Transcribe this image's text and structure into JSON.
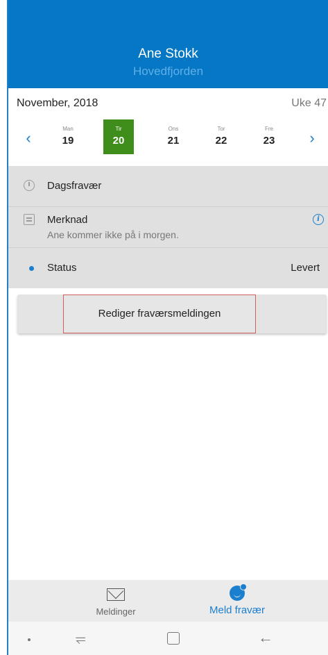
{
  "header": {
    "name": "Ane Stokk",
    "school": "Hovedfjorden"
  },
  "calendar": {
    "month": "November, 2018",
    "week": "Uke 47",
    "prev_icon": "chevron-left-icon",
    "next_icon": "chevron-right-icon",
    "days": [
      {
        "name": "Man",
        "date": "19",
        "selected": false
      },
      {
        "name": "Tir",
        "date": "20",
        "selected": true
      },
      {
        "name": "Ons",
        "date": "21",
        "selected": false
      },
      {
        "name": "Tor",
        "date": "22",
        "selected": false
      },
      {
        "name": "Fre",
        "date": "23",
        "selected": false
      }
    ]
  },
  "details": {
    "absence_type": "Dagsfravær",
    "note_title": "Merknad",
    "note_text": "Ane kommer ikke på i morgen.",
    "status_label": "Status",
    "status_value": "Levert"
  },
  "edit_button": "Rediger fraværsmeldingen",
  "bottom_nav": {
    "messages": "Meldinger",
    "report_absence": "Meld fravær"
  },
  "system_nav": {
    "recent_glyph": "⥫",
    "back_glyph": "←"
  },
  "colors": {
    "header": "#0677c4",
    "selected_day": "#3f8e1c",
    "accent": "#1b7fd0",
    "edit_border": "#cf5d5d"
  }
}
